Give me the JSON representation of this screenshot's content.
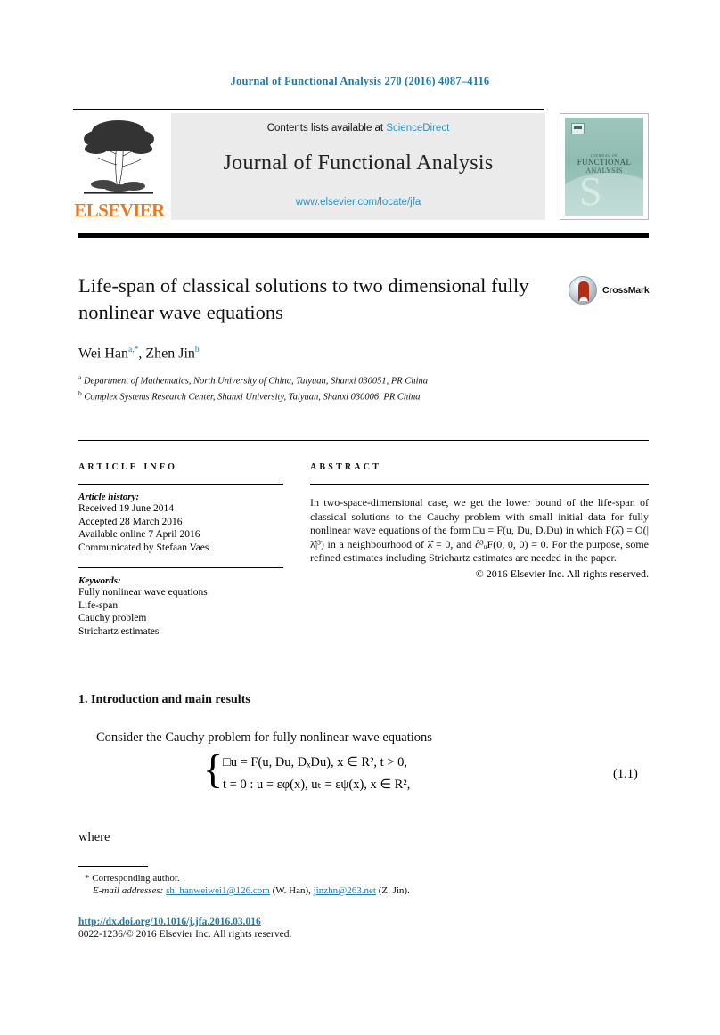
{
  "running_head": "Journal of Functional Analysis 270 (2016) 4087–4116",
  "banner": {
    "contents_prefix": "Contents lists available at ",
    "sciencedirect": "ScienceDirect",
    "journal_title": "Journal of Functional Analysis",
    "journal_url": "www.elsevier.com/locate/jfa",
    "publisher_wordmark": "ELSEVIER",
    "cover": {
      "line1": "JOURNAL OF",
      "line2": "FUNCTIONAL",
      "line3": "ANALYSIS",
      "initial": "S"
    }
  },
  "article": {
    "title": "Life-span of classical solutions to two dimensional fully nonlinear wave equations",
    "crossmark_label": "CrossMark",
    "authors_html": "Wei Han<sup>a,*</sup>, Zhen Jin<sup>b</sup>",
    "affiliation_a": "Department of Mathematics, North University of China, Taiyuan, Shanxi 030051, PR China",
    "affiliation_b": "Complex Systems Research Center, Shanxi University, Taiyuan, Shanxi 030006, PR China"
  },
  "info": {
    "heading": "ARTICLE INFO",
    "history_label": "Article history:",
    "history": [
      "Received 19 June 2014",
      "Accepted 28 March 2016",
      "Available online 7 April 2016",
      "Communicated by Stefaan Vaes"
    ],
    "keywords_label": "Keywords:",
    "keywords": [
      "Fully nonlinear wave equations",
      "Life-span",
      "Cauchy problem",
      "Strichartz estimates"
    ]
  },
  "abstract": {
    "heading": "ABSTRACT",
    "text": "In two-space-dimensional case, we get the lower bound of the life-span of classical solutions to the Cauchy problem with small initial data for fully nonlinear wave equations of the form □u = F(u, Du, DₓDu) in which F(λ̂) = O(|λ̂|³) in a neighbourhood of λ̂ = 0, and ∂³ᵤF(0, 0, 0) = 0. For the purpose, some refined estimates including Strichartz estimates are needed in the paper.",
    "copyright": "© 2016 Elsevier Inc. All rights reserved."
  },
  "body": {
    "section_number_title": "1. Introduction and main results",
    "paragraph_1": "Consider the Cauchy problem for fully nonlinear wave equations",
    "equation": {
      "line1": "□u = F(u, Du, DₓDu),    x ∈ R²,  t > 0,",
      "line2": "t = 0 :  u = εφ(x),     uₜ = εψ(x),   x ∈ R²,",
      "number": "(1.1)"
    },
    "paragraph_2": "where"
  },
  "footer": {
    "corresponding_marker": "*",
    "corresponding_text": "Corresponding author.",
    "email_label": "E-mail addresses:",
    "email_1": "sh_hanweiwei1@126.com",
    "email_1_owner": "(W. Han),",
    "email_2": "jinzhn@263.net",
    "email_2_owner": "(Z. Jin).",
    "doi": "http://dx.doi.org/10.1016/j.jfa.2016.03.016",
    "issn_line": "0022-1236/© 2016 Elsevier Inc. All rights reserved."
  },
  "colors": {
    "link": "#1f7ba8",
    "sciencedirect": "#2a93c9",
    "elsevier_orange": "#E87B22",
    "cover_teal": "#9ec6bd",
    "crossmark_red": "#b32d16"
  }
}
